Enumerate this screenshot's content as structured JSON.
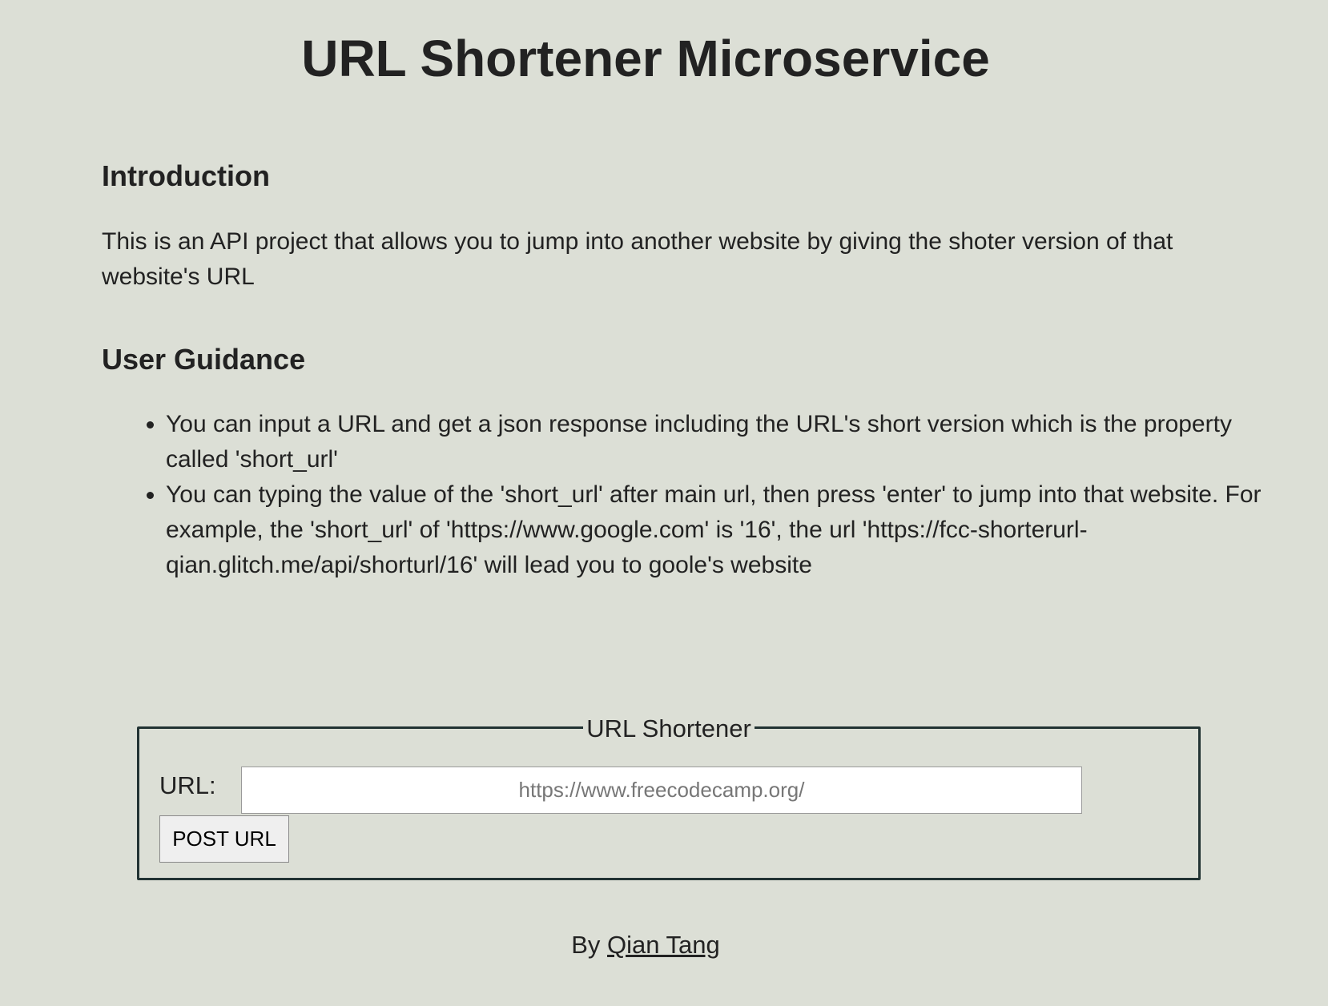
{
  "header": {
    "title": "URL Shortener Microservice"
  },
  "introduction": {
    "heading": "Introduction",
    "text": "This is an API project that allows you to jump into another website by giving the shoter version of that website's URL"
  },
  "guidance": {
    "heading": "User Guidance",
    "items": [
      "You can input a URL and get a json response including the URL's short version which is the property called 'short_url'",
      "You can typing the value of the 'short_url' after main url, then press 'enter' to jump into that website. For example, the 'short_url' of 'https://www.google.com' is '16', the url 'https://fcc-shorterurl-qian.glitch.me/api/shorturl/16' will lead you to goole's website"
    ]
  },
  "form": {
    "legend": "URL Shortener",
    "url_label": "URL:",
    "url_placeholder": "https://www.freecodecamp.org/",
    "url_value": "",
    "submit_label": "POST URL"
  },
  "footer": {
    "by_text": "By",
    "author_link": "Qian Tang"
  },
  "colors": {
    "background": "#dcdfd6",
    "text": "#222222",
    "fieldset_border": "#223333"
  }
}
